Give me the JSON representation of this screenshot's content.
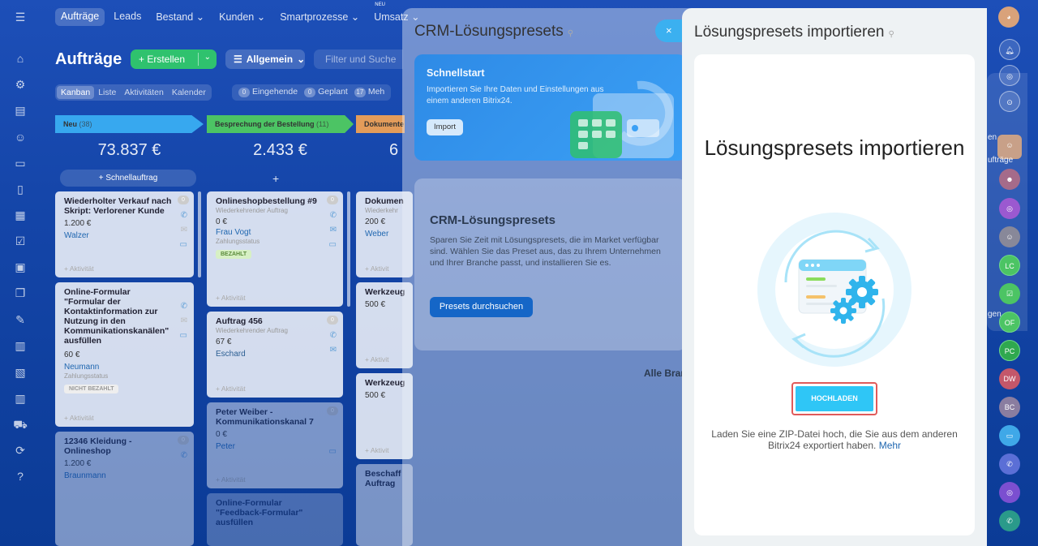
{
  "topnav": {
    "items": [
      "Aufträge",
      "Leads",
      "Bestand",
      "Kunden",
      "Smartprozesse",
      "Umsatz"
    ],
    "new_badge": "NEU"
  },
  "toolbar": {
    "page_title": "Aufträge",
    "create_label": "+ Erstellen",
    "filter_label": "Allgemein",
    "search_placeholder": "Filter und Suche"
  },
  "view_tabs": [
    "Kanban",
    "Liste",
    "Aktivitäten",
    "Kalender"
  ],
  "counters": [
    {
      "count": "0",
      "label": "Eingehende"
    },
    {
      "count": "0",
      "label": "Geplant"
    },
    {
      "count": "17",
      "label": "Meh"
    }
  ],
  "columns": [
    {
      "title": "Neu",
      "count": "(38)",
      "sum": "73.837 €",
      "color": "#37a8ef"
    },
    {
      "title": "Besprechung der Bestellung",
      "count": "(11)",
      "sum": "2.433 €",
      "color": "#4cc464"
    },
    {
      "title": "Dokumente",
      "count": "",
      "sum": "6",
      "color": "#e39c5a"
    }
  ],
  "quick_order": "+ Schnellauftrag",
  "plus": "+",
  "cards": {
    "c1": {
      "title": "Wiederholter Verkauf nach Skript: Verlorener Kunde",
      "amount": "1.200 €",
      "person": "Walzer",
      "activity": "+ Aktivität",
      "count": "0"
    },
    "c2": {
      "title": "Online-Formular \"Formular der Kontaktinformation zur Nutzung in den Kommunikationskanälen\" ausfüllen",
      "amount": "60 €",
      "person": "Neumann",
      "status_label": "Zahlungsstatus",
      "badge": "NICHT BEZAHLT",
      "activity": "+ Aktivität"
    },
    "c3": {
      "title": "12346 Kleidung - Onlineshop",
      "amount": "1.200 €",
      "person": "Braunmann",
      "count": "0"
    },
    "c4": {
      "title": "Onlineshopbestellung #9",
      "sub": "Wiederkehrender Auftrag",
      "amount": "0 €",
      "person": "Frau Vogt",
      "status_label": "Zahlungsstatus",
      "badge": "BEZAHLT",
      "activity": "+ Aktivität",
      "count": "0"
    },
    "c5": {
      "title": "Auftrag 456",
      "sub": "Wiederkehrender Auftrag",
      "amount": "67 €",
      "person": "Eschard",
      "activity": "+ Aktivität",
      "count": "0"
    },
    "c6": {
      "title": "Peter Weiber - Kommunikationskanal 7",
      "amount": "0 €",
      "person": "Peter",
      "activity": "+ Aktivität",
      "count": "0"
    },
    "c7": {
      "title": "Online-Formular \"Feedback-Formular\" ausfüllen"
    },
    "c8": {
      "title": "Dokumen",
      "sub": "Wiederkehr",
      "amount": "200 €",
      "person": "Weber",
      "activity": "+ Aktivit"
    },
    "c9": {
      "title": "Werkzeug",
      "amount": "500 €",
      "activity": "+ Aktivit"
    },
    "c10": {
      "title": "Werkzeug",
      "amount": "500 €",
      "activity": "+ Aktivit"
    },
    "c11": {
      "title": "Beschaff Auftrag"
    }
  },
  "middle_panel": {
    "title": "CRM-Lösungspresets",
    "close": "×",
    "quickstart": {
      "title": "Schnellstart",
      "desc": "Importieren Sie Ihre Daten und Einstellungen aus einem anderen Bitrix24.",
      "button": "Import"
    },
    "presets": {
      "title": "CRM-Lösungspresets",
      "desc": "Sparen Sie Zeit mit Lösungspresets, die im Market verfügbar sind. Wählen Sie das Preset aus, das zu Ihrem Unternehmen und Ihrer Branche passt, und installieren Sie es.",
      "button": "Presets durchsuchen"
    },
    "all_branches": "Alle Bran"
  },
  "front_panel": {
    "title": "Lösungspresets importieren",
    "heading": "Lösungspresets importieren",
    "upload_button": "HOCHLADEN",
    "hint": "Laden Sie eine ZIP-Datei hoch, die Sie aus dem anderen Bitrix24 exportiert haben.",
    "hint_link": "Mehr"
  },
  "right_bar": {
    "text_en": "en",
    "text_auftrage": "ufträge",
    "text_gen": "gen",
    "avatars": [
      "LC",
      "OF",
      "PC",
      "DW",
      "BC"
    ]
  },
  "colors": {
    "accent": "#2fc6f6",
    "create_green": "#2fc26e",
    "highlight_red": "#e05a5a"
  }
}
